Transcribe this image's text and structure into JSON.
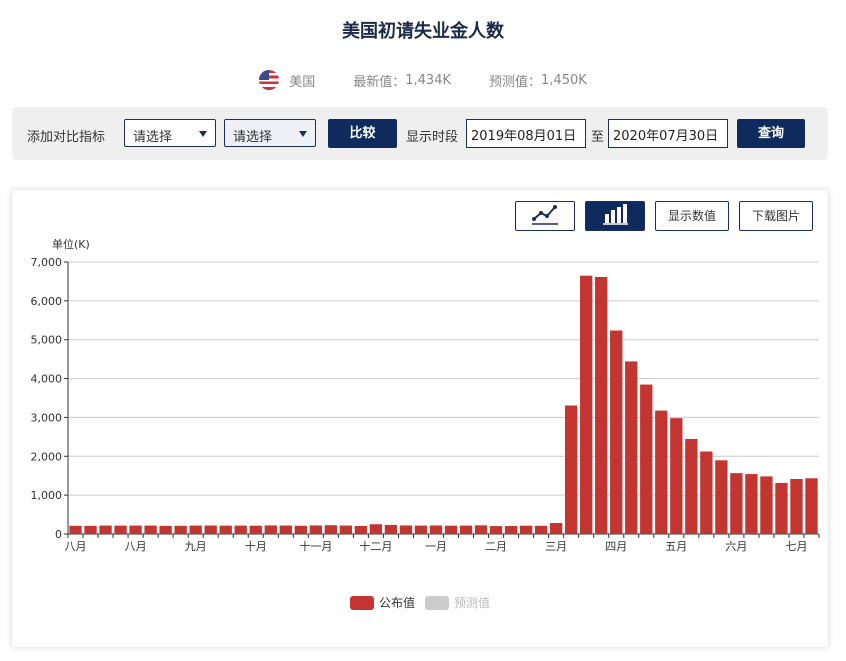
{
  "page": {
    "title": "美国初请失业金人数",
    "country": "美国",
    "latest_label": "最新值：",
    "latest_value": "1,434K",
    "forecast_label": "预测值：",
    "forecast_value": "1,450K"
  },
  "toolbar": {
    "compare_label": "添加对比指标",
    "select1": "请选择",
    "select2": "请选择",
    "compare_button": "比较",
    "period_label": "显示时段",
    "start_date": "2019年08月01日",
    "to_label": "至",
    "end_date": "2020年07月30日",
    "query_button": "查询"
  },
  "chart_tools": {
    "line_icon": "line-chart-icon",
    "bar_icon": "bar-chart-icon",
    "show_values": "显示数值",
    "download": "下载图片"
  },
  "colors": {
    "bar": "#c23531",
    "forecast": "#cccccc",
    "navy": "#0f2a5c"
  },
  "chart_data": {
    "type": "bar",
    "ylabel": "单位(K)",
    "ylim": [
      0,
      7000
    ],
    "y_ticks": [
      "0",
      "1,000",
      "2,000",
      "3,000",
      "4,000",
      "5,000",
      "6,000",
      "7,000"
    ],
    "x_tick_labels": [
      {
        "label": "八月",
        "index": 0
      },
      {
        "label": "八月",
        "index": 4
      },
      {
        "label": "九月",
        "index": 8
      },
      {
        "label": "十月",
        "index": 12
      },
      {
        "label": "十一月",
        "index": 16
      },
      {
        "label": "十二月",
        "index": 20
      },
      {
        "label": "一月",
        "index": 24
      },
      {
        "label": "二月",
        "index": 28
      },
      {
        "label": "三月",
        "index": 32
      },
      {
        "label": "四月",
        "index": 36
      },
      {
        "label": "五月",
        "index": 40
      },
      {
        "label": "六月",
        "index": 44
      },
      {
        "label": "七月",
        "index": 48
      }
    ],
    "series": [
      {
        "name": "公布值",
        "values": [
          211,
          210,
          217,
          215,
          217,
          216,
          209,
          212,
          217,
          218,
          215,
          216,
          214,
          220,
          218,
          211,
          220,
          226,
          218,
          206,
          251,
          234,
          220,
          216,
          220,
          214,
          216,
          223,
          203,
          205,
          214,
          211,
          282,
          3307,
          6648,
          6615,
          5237,
          4442,
          3846,
          3176,
          2981,
          2446,
          2123,
          1897,
          1566,
          1542,
          1482,
          1314,
          1416,
          1434
        ]
      },
      {
        "name": "预测值",
        "values": []
      }
    ],
    "legend": [
      "公布值",
      "预测值"
    ],
    "legend_position": "bottom-center"
  }
}
